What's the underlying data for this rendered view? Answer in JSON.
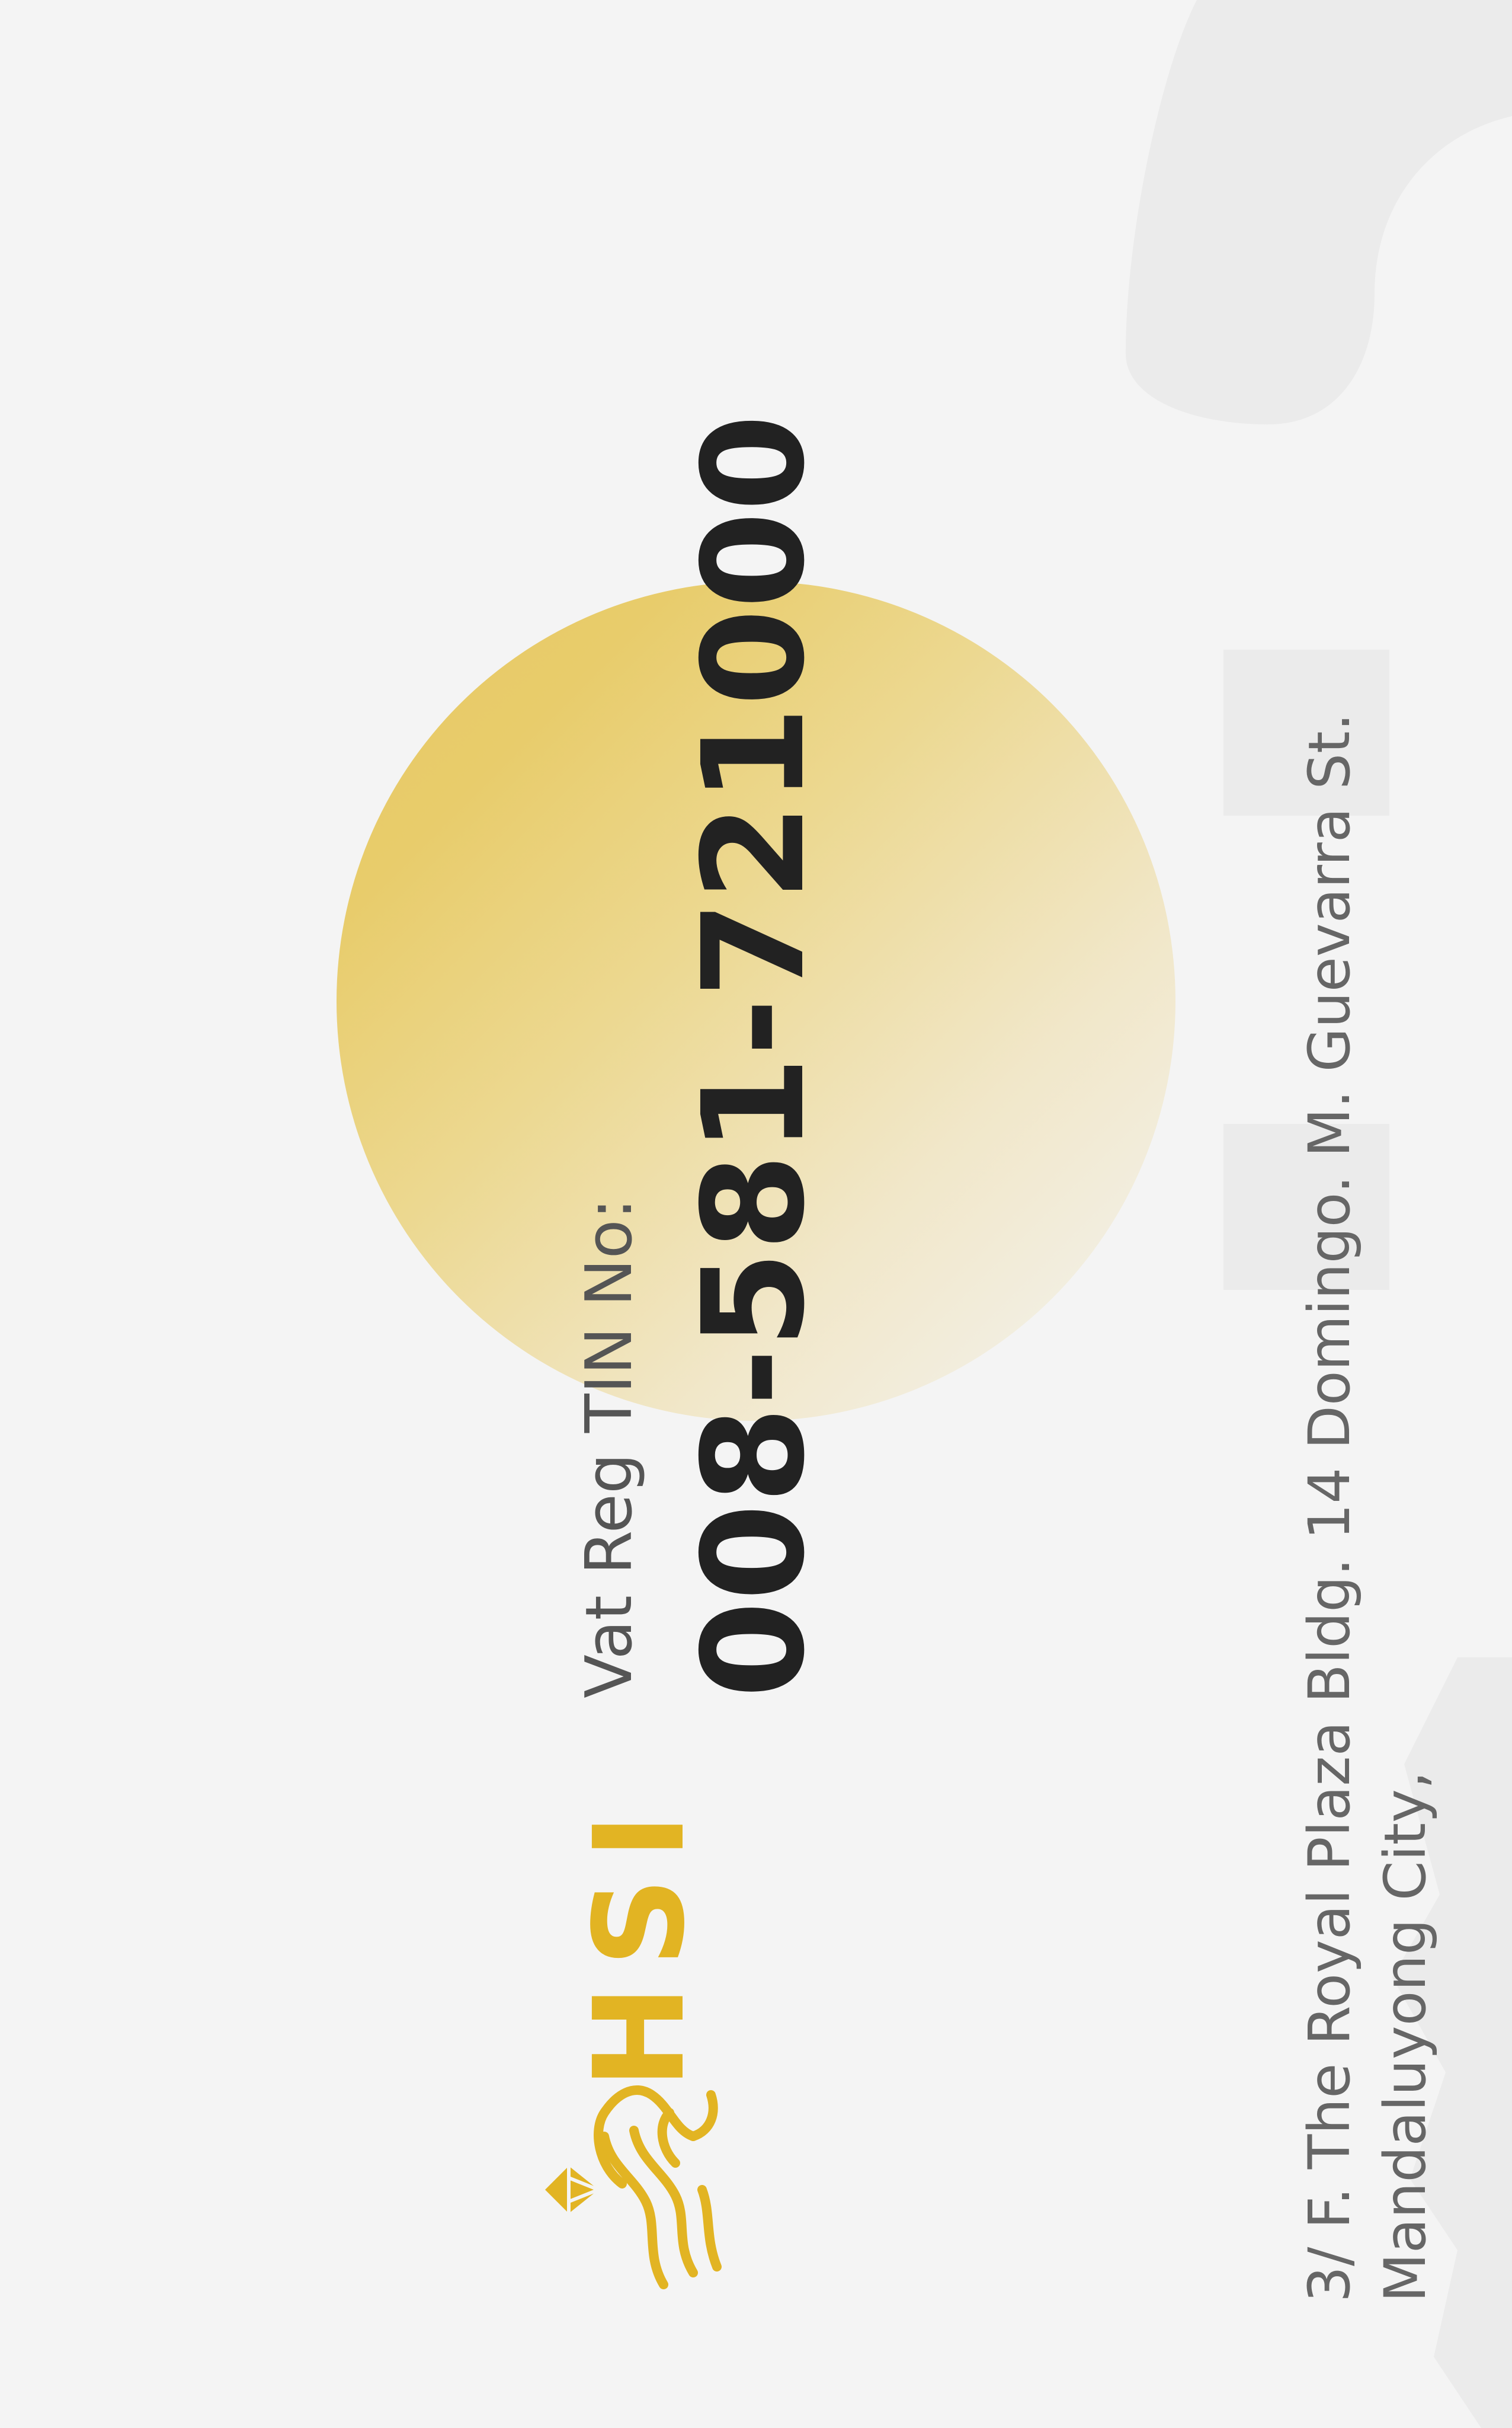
{
  "tin": {
    "label": "Vat Reg TIN No:",
    "number": "008-581-721000"
  },
  "brand": {
    "name": "HSI",
    "logo_icon": "lion-diamond-icon",
    "color": "#e2b423"
  },
  "address": {
    "line1": "3/ F. The Royal Plaza Bldg. 14 Domingo. M. Guevarra St.",
    "line2": "Mandaluyong City,"
  },
  "colors": {
    "background": "#f4f4f4",
    "accent_gold": "#e7c864",
    "text_dark": "#222222",
    "text_muted": "#666666"
  }
}
